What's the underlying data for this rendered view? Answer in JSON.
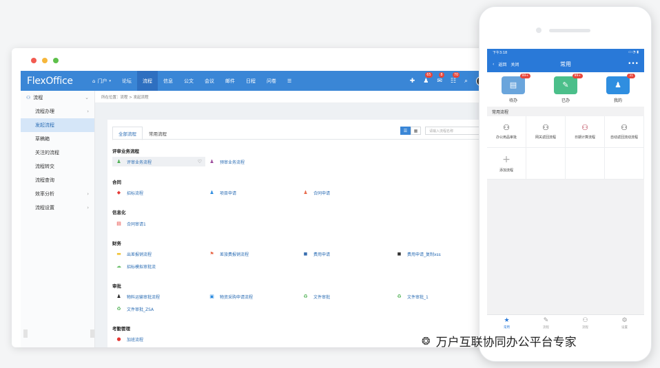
{
  "window": {
    "logo": "FlexOffice"
  },
  "nav": {
    "items": [
      {
        "label": "门户",
        "icon": "home-icon"
      },
      {
        "label": "论坛"
      },
      {
        "label": "流程",
        "active": true
      },
      {
        "label": "信息"
      },
      {
        "label": "公文"
      },
      {
        "label": "会议"
      },
      {
        "label": "邮件"
      },
      {
        "label": "日程"
      },
      {
        "label": "问卷"
      }
    ],
    "badges": {
      "notify": "65",
      "msg": "8",
      "todo": "70"
    }
  },
  "sidebar": {
    "header": "流程",
    "items": [
      {
        "label": "流程办理",
        "arrow": true
      },
      {
        "label": "发起流程",
        "selected": true
      },
      {
        "label": "草稿箱"
      },
      {
        "label": "关注的流程"
      },
      {
        "label": "流程转交"
      },
      {
        "label": "流程查询"
      },
      {
        "label": "效率分析",
        "arrow": true
      },
      {
        "label": "流程设置",
        "arrow": true
      }
    ]
  },
  "main": {
    "breadcrumb": "所在位置：流程 > 发起流程",
    "tabs": [
      "全部流程",
      "常用流程"
    ],
    "search_placeholder": "请输入流程名称",
    "sections": [
      {
        "title": "评审业务流程",
        "flows": [
          {
            "label": "评审业务流程",
            "icon": "person-icon",
            "color": "#4caf50"
          },
          {
            "label": "预审业务流程",
            "icon": "person-icon",
            "color": "#9c4a9c"
          }
        ]
      },
      {
        "title": "合同",
        "flows": [
          {
            "label": "招标流程",
            "icon": "tag-icon",
            "color": "#e53935"
          },
          {
            "label": "项目申请",
            "icon": "person-icon",
            "color": "#2b8be0"
          },
          {
            "label": "合同申请",
            "icon": "person-icon",
            "color": "#e86a4a"
          }
        ]
      },
      {
        "title": "信息化",
        "flows": [
          {
            "label": "合同审请1",
            "icon": "doc-icon",
            "color": "#e53935"
          }
        ]
      },
      {
        "title": "财务",
        "flows": [
          {
            "label": "出差报销流程",
            "icon": "bag-icon",
            "color": "#f1c232"
          },
          {
            "label": "差旅费报销流程",
            "icon": "flag-icon",
            "color": "#e86a4a"
          },
          {
            "label": "费用申请",
            "icon": "chat-icon",
            "color": "#3a6fb0"
          },
          {
            "label": "费用申请_复制xss",
            "icon": "chat-icon",
            "color": "#333333"
          },
          {
            "label": "招标模拟审批流",
            "icon": "cloud-icon",
            "color": "#6abf69"
          }
        ]
      },
      {
        "title": "审批",
        "flows": [
          {
            "label": "物料运输审批流程",
            "icon": "person-icon",
            "color": "#222222"
          },
          {
            "label": "物资采购申请流程",
            "icon": "box-icon",
            "color": "#2b8be0"
          },
          {
            "label": "文件审批",
            "icon": "recycle-icon",
            "color": "#4caf50"
          },
          {
            "label": "文件审批_1",
            "icon": "recycle-icon",
            "color": "#4caf50"
          },
          {
            "label": "文件审批_ZSA",
            "icon": "recycle-icon",
            "color": "#4caf50"
          }
        ]
      },
      {
        "title": "考勤管理",
        "flows": [
          {
            "label": "加班流程",
            "icon": "circle-icon",
            "color": "#e53935"
          }
        ]
      }
    ]
  },
  "phone": {
    "status_time": "下午3:18",
    "back": "返回",
    "close": "关闭",
    "title": "常用",
    "quick": [
      {
        "label": "待办",
        "badge": "99+",
        "color": "#6aa5dc",
        "icon": "doc-icon"
      },
      {
        "label": "已办",
        "badge": "99+",
        "color": "#4bbf8a",
        "icon": "edit-icon"
      },
      {
        "label": "我的",
        "badge": "31",
        "color": "#2f8ee0",
        "icon": "user-icon"
      }
    ],
    "section": "常用流程",
    "flows": [
      "办公用品审批",
      "网关返回流程",
      "日期计算流程",
      "自动返回流动流程"
    ],
    "add": "添加流程",
    "tabbar": [
      "常用",
      "流程",
      "流程",
      "设置"
    ]
  },
  "watermark": "万户互联协同办公平台专家"
}
